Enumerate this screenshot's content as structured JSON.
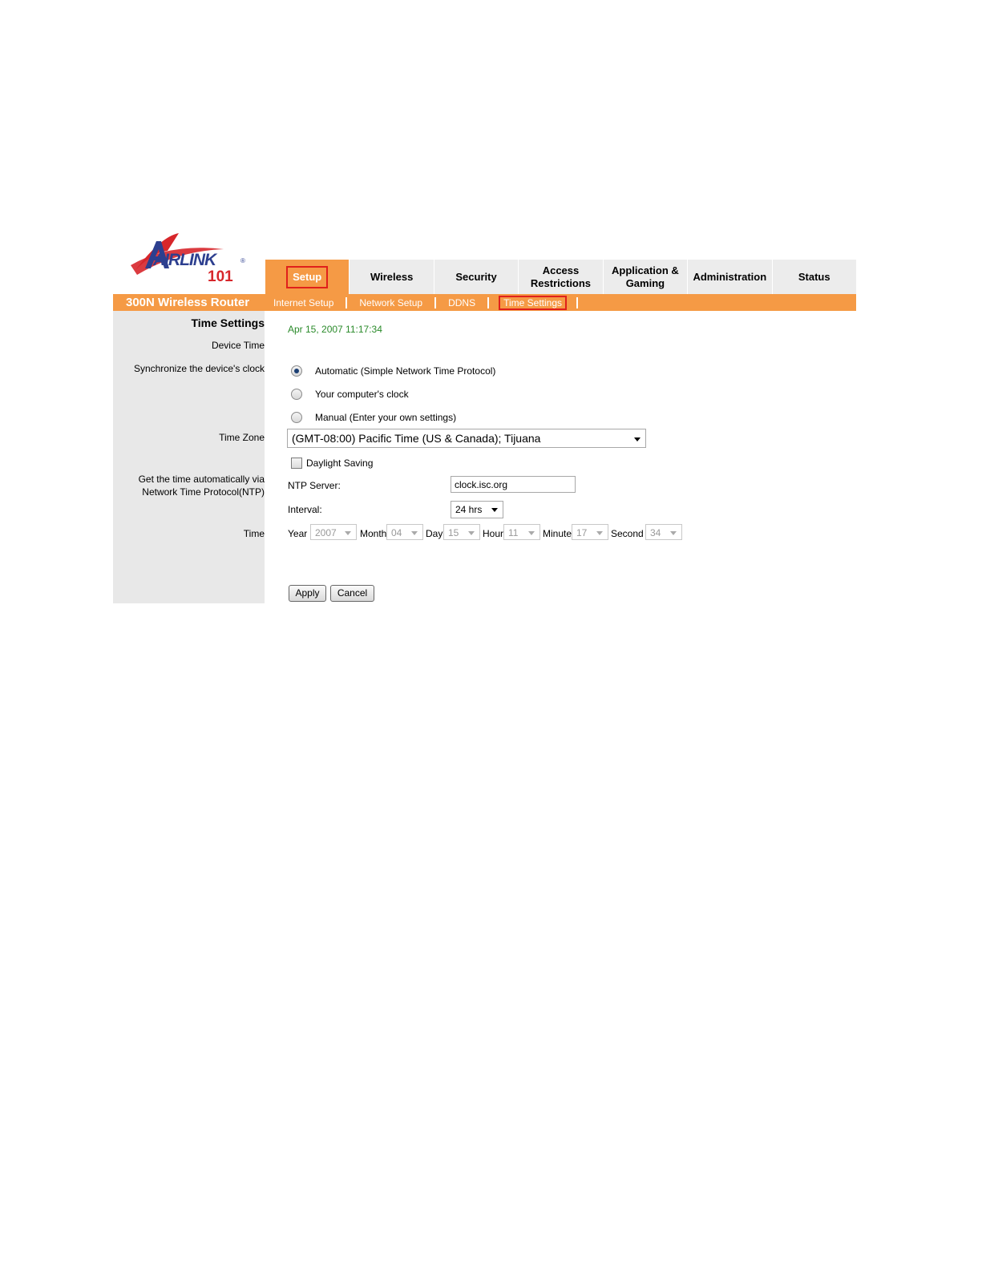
{
  "logo": {
    "text": "AIRLINK",
    "number": "101",
    "registered": "®"
  },
  "nav": {
    "tabs": [
      {
        "line1": "Setup",
        "line2": "",
        "active": true
      },
      {
        "line1": "Wireless",
        "line2": ""
      },
      {
        "line1": "Security",
        "line2": ""
      },
      {
        "line1": "Access",
        "line2": "Restrictions"
      },
      {
        "line1": "Application &",
        "line2": "Gaming"
      },
      {
        "line1": "Administration",
        "line2": ""
      },
      {
        "line1": "Status",
        "line2": ""
      }
    ]
  },
  "product_name": "300N Wireless Router",
  "subnav": {
    "items": [
      "Internet Setup",
      "Network Setup",
      "DDNS",
      "Time Settings"
    ],
    "active": "Time Settings"
  },
  "labels": {
    "section_title": "Time Settings",
    "device_time": "Device Time",
    "sync": "Synchronize the device's clock",
    "time_zone": "Time Zone",
    "ntp_line1": "Get the time automatically via",
    "ntp_line2": "Network Time Protocol(NTP)",
    "time": "Time"
  },
  "device_time_value": "Apr 15, 2007 11:17:34",
  "sync_options": [
    {
      "label": "Automatic (Simple Network Time Protocol)",
      "selected": true
    },
    {
      "label": "Your computer's clock",
      "selected": false
    },
    {
      "label": "Manual (Enter your own settings)",
      "selected": false
    }
  ],
  "time_zone_value": "(GMT-08:00) Pacific Time (US & Canada); Tijuana",
  "daylight_saving": {
    "label": "Daylight Saving",
    "checked": false
  },
  "ntp": {
    "server_label": "NTP Server:",
    "server_value": "clock.isc.org",
    "interval_label": "Interval:",
    "interval_value": "24 hrs"
  },
  "manual_time": {
    "year_label": "Year",
    "year": "2007",
    "month_label": "Month",
    "month": "04",
    "day_label": "Day",
    "day": "15",
    "hour_label": "Hour",
    "hour": "11",
    "minute_label": "Minute",
    "minute": "17",
    "second_label": "Second",
    "second": "34"
  },
  "buttons": {
    "apply": "Apply",
    "cancel": "Cancel"
  },
  "colors": {
    "accent": "#f59a45",
    "highlight_box": "#e0201b",
    "device_time": "#2a8a2a",
    "logo_red": "#d7262b",
    "logo_blue": "#2d3f8f"
  }
}
